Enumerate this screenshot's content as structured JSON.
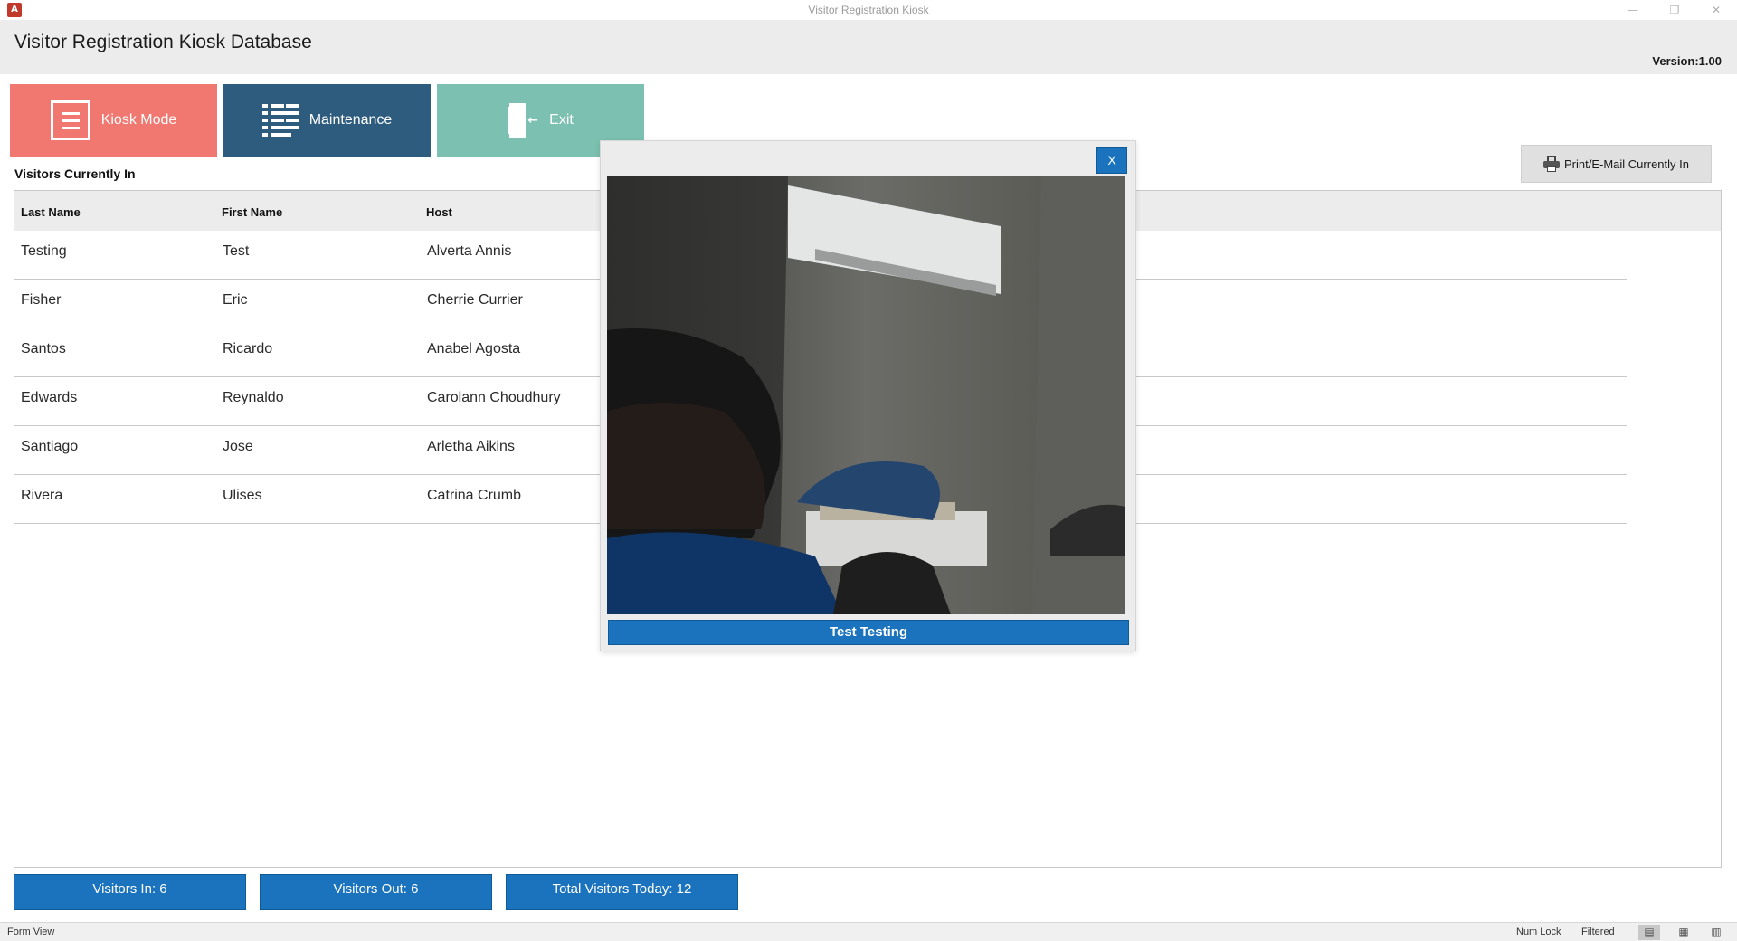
{
  "window": {
    "title": "Visitor Registration Kiosk",
    "app_icon_text": "A",
    "controls": {
      "minimize": "—",
      "maximize": "❐",
      "close": "✕"
    }
  },
  "header": {
    "title": "Visitor Registration Kiosk Database",
    "version": "Version:1.00"
  },
  "nav": {
    "kiosk_label": "Kiosk Mode",
    "maintenance_label": "Maintenance",
    "exit_label": "Exit",
    "exit_arrow": "←"
  },
  "section_title": "Visitors Currently In",
  "print_button": "Print/E-Mail Currently In",
  "table": {
    "columns": [
      "Last Name",
      "First Name",
      "Host"
    ],
    "rows": [
      [
        "Testing",
        "Test",
        "Alverta Annis"
      ],
      [
        "Fisher",
        "Eric",
        "Cherrie Currier"
      ],
      [
        "Santos",
        "Ricardo",
        "Anabel Agosta"
      ],
      [
        "Edwards",
        "Reynaldo",
        "Carolann Choudhury"
      ],
      [
        "Santiago",
        "Jose",
        "Arletha Aikins"
      ],
      [
        "Rivera",
        "Ulises",
        "Catrina Crumb"
      ]
    ]
  },
  "stats": {
    "visitors_in": "Visitors In: 6",
    "visitors_out": "Visitors Out: 6",
    "total_today": "Total Visitors Today: 12"
  },
  "statusbar": {
    "view": "Form View",
    "num_lock": "Num Lock",
    "filtered": "Filtered",
    "view_icons": [
      "▤",
      "▦",
      "▥"
    ]
  },
  "popup": {
    "close_label": "X",
    "visitor_name": "Test Testing"
  },
  "colors": {
    "kiosk": "#f07870",
    "maintenance": "#2e5c7e",
    "exit": "#7bc0b0",
    "accent_blue": "#1b73be"
  }
}
